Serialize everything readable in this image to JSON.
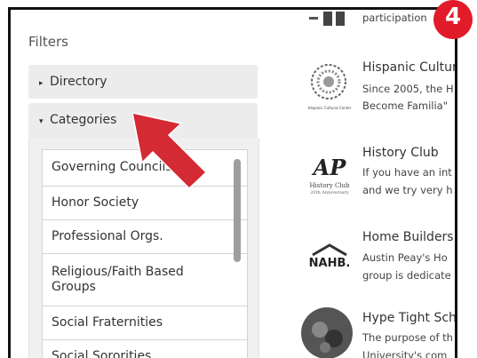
{
  "filters": {
    "title": "Filters",
    "directory_label": "Directory",
    "categories_label": "Categories"
  },
  "categories": [
    {
      "label": "Governing Councils"
    },
    {
      "label": "Honor Society"
    },
    {
      "label": "Professional Orgs."
    },
    {
      "label": "Religious/Faith Based Groups"
    },
    {
      "label": "Social Fraternities"
    },
    {
      "label": "Social Sororities"
    }
  ],
  "results": [
    {
      "title": "",
      "desc1": "participation",
      "desc2": "",
      "logo_text": ""
    },
    {
      "title": "Hispanic Cultur",
      "desc1": "Since 2005, the H",
      "desc2": "Become Familia\"",
      "logo_text": "Hispanic Cultural Center"
    },
    {
      "title": "History Club",
      "desc1": "If you have an int",
      "desc2": "and we try very h",
      "logo_text": "History Club",
      "logo_sub": "20th Anniversary",
      "logo_mark": "AP"
    },
    {
      "title": "Home Builders",
      "desc1": "Austin Peay's Ho",
      "desc2": "group is dedicate",
      "logo_text": "NAHB."
    },
    {
      "title": "Hype Tight Sch",
      "desc1": "The purpose of th",
      "desc2": "University's com",
      "logo_text": ""
    }
  ],
  "callout": {
    "step": "4",
    "badge_color": "#e11b2a",
    "arrow_color": "#d42a33"
  },
  "icons": {
    "collapsed": "caret-right-icon",
    "expanded": "caret-down-icon"
  }
}
